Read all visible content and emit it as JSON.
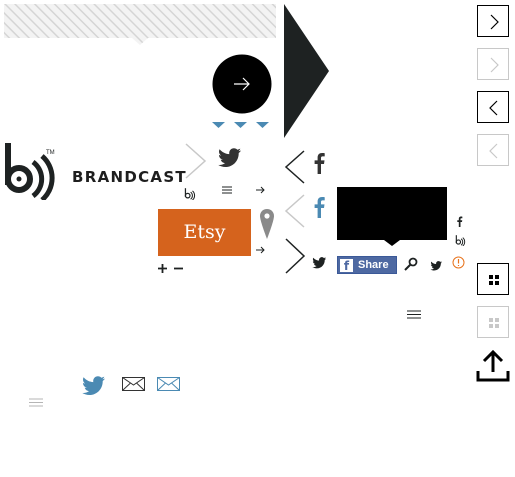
{
  "brand": {
    "word": "BRANDCAST",
    "trademark": "TM"
  },
  "etsy": {
    "label": "Etsy"
  },
  "facebook_share": {
    "icon_letter": "f",
    "label": "Share"
  },
  "icons": [
    "hatched-banner",
    "circle-arrow-right-icon",
    "caret-down-icon",
    "brandcast-logo-icon",
    "chevron-right-icon",
    "chevron-left-icon",
    "twitter-icon",
    "facebook-icon",
    "hamburger-menu-icon",
    "arrow-right-icon",
    "map-pin-icon",
    "plus-icon",
    "minus-icon",
    "search-icon",
    "alert-icon",
    "grid-icon",
    "share-upload-icon",
    "mail-icon"
  ],
  "colors": {
    "dark": "#1e2222",
    "twitter_blue": "#4b8ab3",
    "facebook_blue": "#4e69a2",
    "etsy_orange": "#d5631d",
    "alert_orange": "#e8731c",
    "hatch_gray": "#d9d9d9"
  }
}
